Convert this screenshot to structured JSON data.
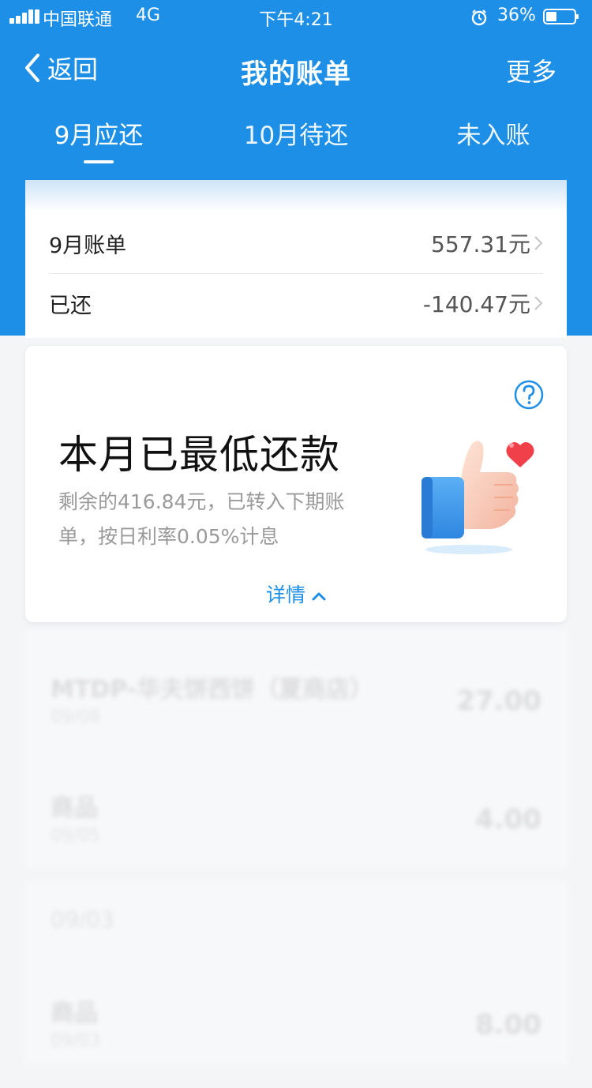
{
  "status_bar": {
    "carrier": "中国联通",
    "network": "4G",
    "time": "下午4:21",
    "battery": "36%"
  },
  "nav": {
    "back_label": "返回",
    "title": "我的账单",
    "more_label": "更多"
  },
  "tabs": [
    {
      "label": "9月应还",
      "active": true
    },
    {
      "label": "10月待还",
      "active": false
    },
    {
      "label": "未入账",
      "active": false
    }
  ],
  "summary": {
    "bill_label": "9月账单",
    "bill_value": "557.31元",
    "paid_label": "已还",
    "paid_value": "-140.47元"
  },
  "status_card": {
    "title": "本月已最低还款",
    "desc_line1": "剩余的416.84元，已转入下期账",
    "desc_line2": "单，按日利率0.05%计息",
    "detail_label": "详情"
  },
  "transactions": {
    "items": [
      {
        "name": "MTDP-华夫饼西饼（夏商店）",
        "sub": "09/08",
        "amount": "27.00"
      },
      {
        "name": "商品",
        "sub": "09/05",
        "amount": "4.00"
      }
    ],
    "group2_title": "09/03",
    "group2_items": [
      {
        "name": "商品",
        "sub": "09/03",
        "amount": "8.00"
      }
    ]
  },
  "colors": {
    "brand_blue": "#1e8fe6",
    "background": "#f4f5f7",
    "heart_red": "#f0404a"
  }
}
